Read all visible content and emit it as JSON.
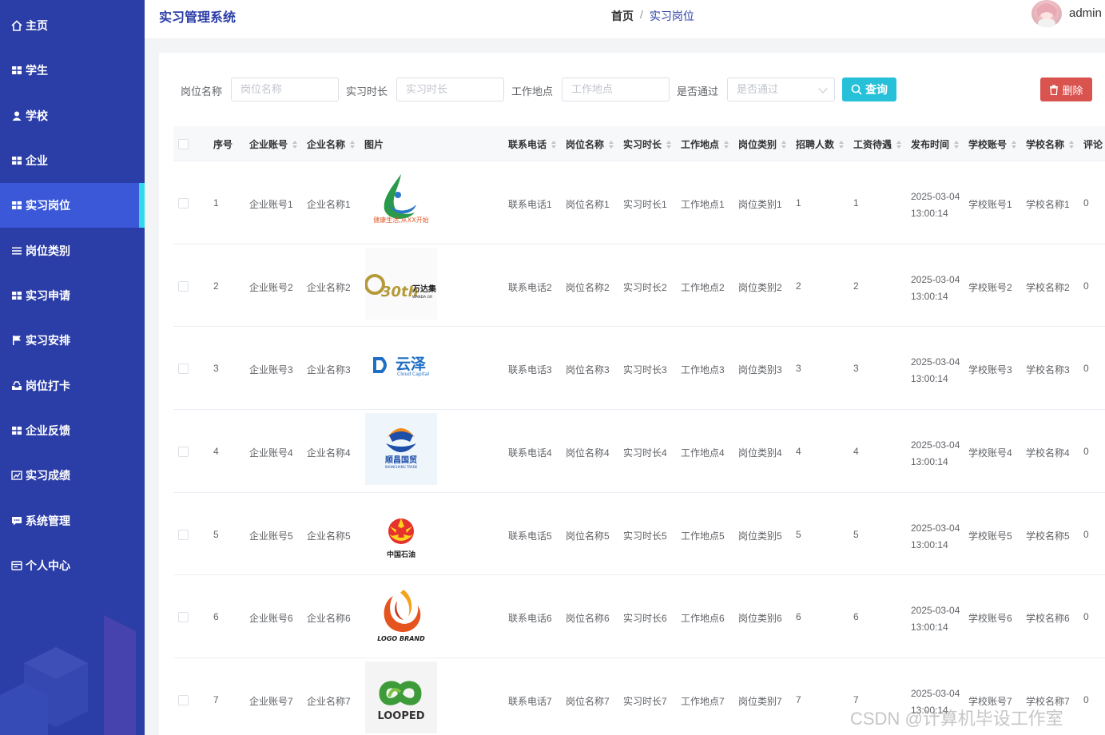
{
  "app": {
    "title": "实习管理系统",
    "user": "admin"
  },
  "breadcrumb": {
    "home": "首页",
    "sep": "/",
    "current": "实习岗位"
  },
  "sidebar": {
    "items": [
      {
        "label": "主页",
        "icon": "home-icon"
      },
      {
        "label": "学生",
        "icon": "grid-icon"
      },
      {
        "label": "学校",
        "icon": "user-icon"
      },
      {
        "label": "企业",
        "icon": "grid-icon"
      },
      {
        "label": "实习岗位",
        "icon": "grid-icon",
        "active": true
      },
      {
        "label": "岗位类别",
        "icon": "list-icon"
      },
      {
        "label": "实习申请",
        "icon": "grid-icon"
      },
      {
        "label": "实习安排",
        "icon": "flag-icon"
      },
      {
        "label": "岗位打卡",
        "icon": "inbox-icon"
      },
      {
        "label": "企业反馈",
        "icon": "grid-icon"
      },
      {
        "label": "实习成绩",
        "icon": "chart-icon"
      },
      {
        "label": "系统管理",
        "icon": "chat-icon"
      },
      {
        "label": "个人中心",
        "icon": "card-icon"
      }
    ]
  },
  "search": {
    "fields": [
      {
        "label": "岗位名称",
        "placeholder": "岗位名称"
      },
      {
        "label": "实习时长",
        "placeholder": "实习时长"
      },
      {
        "label": "工作地点",
        "placeholder": "工作地点"
      },
      {
        "label": "是否通过",
        "placeholder": "是否通过"
      }
    ],
    "query_label": "查询",
    "delete_label": "删除"
  },
  "table": {
    "headers": [
      "序号",
      "企业账号",
      "企业名称",
      "图片",
      "联系电话",
      "岗位名称",
      "实习时长",
      "工作地点",
      "岗位类别",
      "招聘人数",
      "工资待遇",
      "发布时间",
      "学校账号",
      "学校名称",
      "评论"
    ],
    "rows": [
      {
        "no": "1",
        "account": "企业账号1",
        "name": "企业名称1",
        "logo": "logo-1-green-water",
        "phone": "联系电话1",
        "job": "岗位名称1",
        "duration": "实习时长1",
        "place": "工作地点1",
        "type": "岗位类别1",
        "count": "1",
        "salary": "1",
        "date": "2025-03-04",
        "time": "13:00:14",
        "school_acc": "学校账号1",
        "school": "学校名称1",
        "comment": "0"
      },
      {
        "no": "2",
        "account": "企业账号2",
        "name": "企业名称2",
        "logo": "logo-2-wanda",
        "phone": "联系电话2",
        "job": "岗位名称2",
        "duration": "实习时长2",
        "place": "工作地点2",
        "type": "岗位类别2",
        "count": "2",
        "salary": "2",
        "date": "2025-03-04",
        "time": "13:00:14",
        "school_acc": "学校账号2",
        "school": "学校名称2",
        "comment": "0"
      },
      {
        "no": "3",
        "account": "企业账号3",
        "name": "企业名称3",
        "logo": "logo-3-yunze",
        "phone": "联系电话3",
        "job": "岗位名称3",
        "duration": "实习时长3",
        "place": "工作地点3",
        "type": "岗位类别3",
        "count": "3",
        "salary": "3",
        "date": "2025-03-04",
        "time": "13:00:14",
        "school_acc": "学校账号3",
        "school": "学校名称3",
        "comment": "0"
      },
      {
        "no": "4",
        "account": "企业账号4",
        "name": "企业名称4",
        "logo": "logo-4-shunchang",
        "phone": "联系电话4",
        "job": "岗位名称4",
        "duration": "实习时长4",
        "place": "工作地点4",
        "type": "岗位类别4",
        "count": "4",
        "salary": "4",
        "date": "2025-03-04",
        "time": "13:00:14",
        "school_acc": "学校账号4",
        "school": "学校名称4",
        "comment": "0"
      },
      {
        "no": "5",
        "account": "企业账号5",
        "name": "企业名称5",
        "logo": "logo-5-petrochina",
        "phone": "联系电话5",
        "job": "岗位名称5",
        "duration": "实习时长5",
        "place": "工作地点5",
        "type": "岗位类别5",
        "count": "5",
        "salary": "5",
        "date": "2025-03-04",
        "time": "13:00:14",
        "school_acc": "学校账号5",
        "school": "学校名称5",
        "comment": "0"
      },
      {
        "no": "6",
        "account": "企业账号6",
        "name": "企业名称6",
        "logo": "logo-6-logo-brand",
        "phone": "联系电话6",
        "job": "岗位名称6",
        "duration": "实习时长6",
        "place": "工作地点6",
        "type": "岗位类别6",
        "count": "6",
        "salary": "6",
        "date": "2025-03-04",
        "time": "13:00:14",
        "school_acc": "学校账号6",
        "school": "学校名称6",
        "comment": "0"
      },
      {
        "no": "7",
        "account": "企业账号7",
        "name": "企业名称7",
        "logo": "logo-7-looped",
        "phone": "联系电话7",
        "job": "岗位名称7",
        "duration": "实习时长7",
        "place": "工作地点7",
        "type": "岗位类别7",
        "count": "7",
        "salary": "7",
        "date": "2025-03-04",
        "time": "13:00:14",
        "school_acc": "学校账号7",
        "school": "学校名称7",
        "comment": "0"
      }
    ]
  },
  "logos": {
    "l1": "健康生活,从XX开始",
    "l2_num": "30th",
    "l2_cn": "万达集",
    "l2_en": "WANDA GR",
    "l3_cn": "云泽",
    "l3_en": "Cloud Capital",
    "l4_cn": "顺昌国贸",
    "l4_en": "SHUNCHANG TRADE",
    "l5": "中国石油",
    "l6": "LOGO BRAND",
    "l7": "LOOPED"
  },
  "watermark": "CSDN @计算机毕设工作室",
  "colors": {
    "sidebar": "#2b3da6",
    "active": "#3a58d8",
    "accent": "#32d9ee",
    "query": "#26c1d9",
    "delete": "#d9534f"
  }
}
